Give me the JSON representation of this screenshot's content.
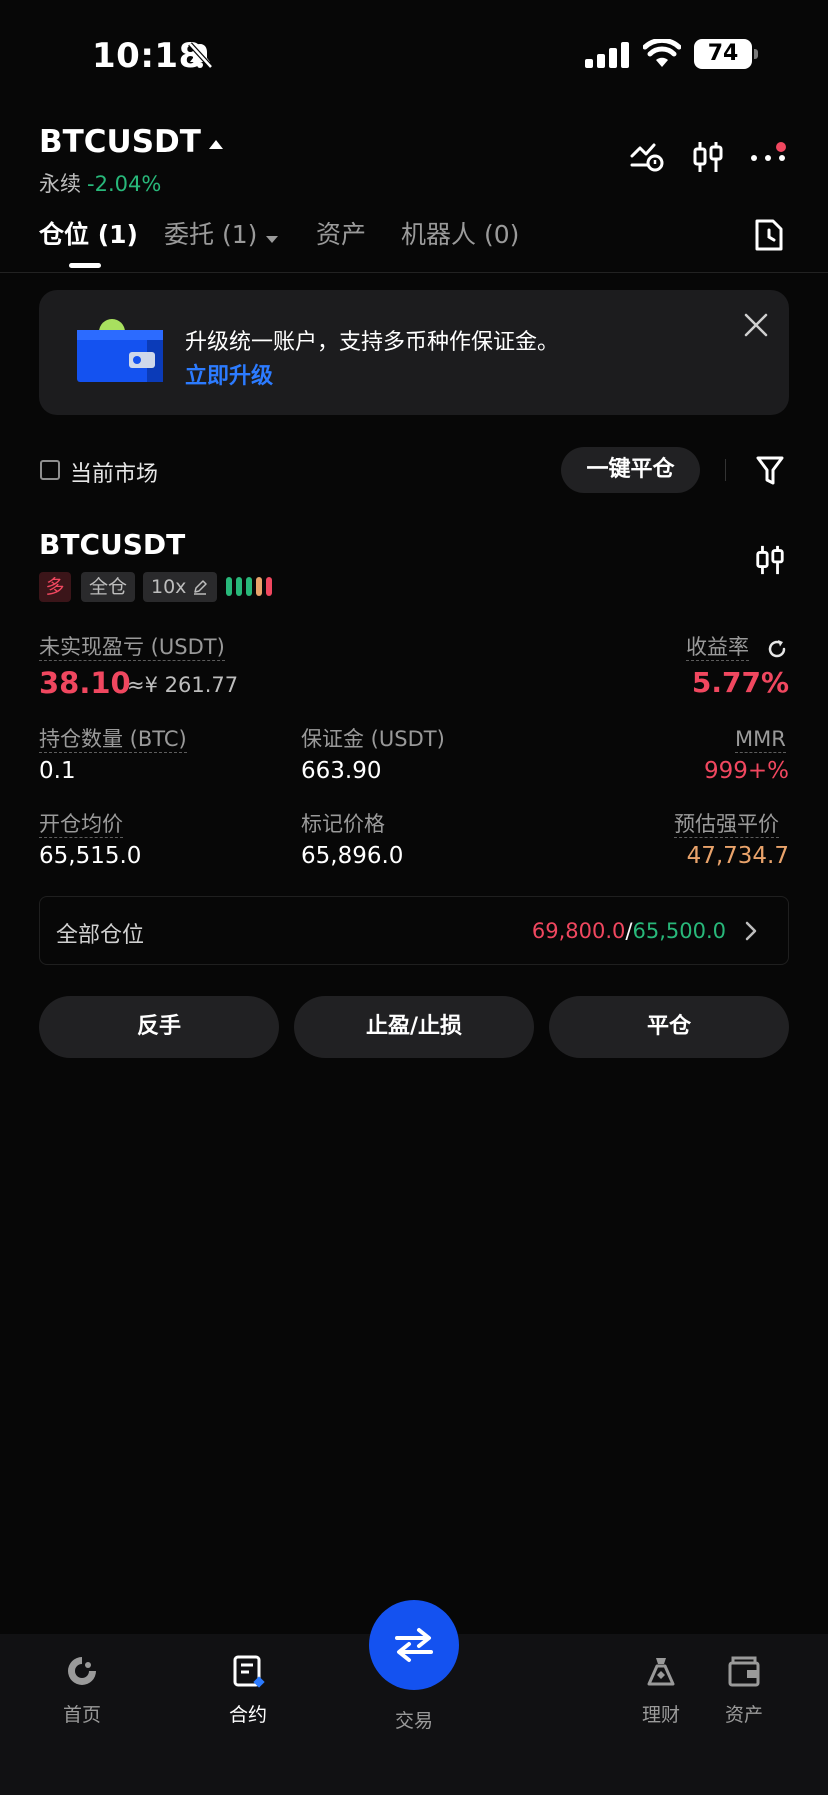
{
  "status_bar": {
    "time": "10:18",
    "battery": "74"
  },
  "header": {
    "pair": "BTCUSDT",
    "type": "永续",
    "change": "-2.04%"
  },
  "tabs": [
    {
      "label": "仓位 (1)"
    },
    {
      "label": "委托 (1)"
    },
    {
      "label": "资产"
    },
    {
      "label": "机器人 (0)"
    }
  ],
  "banner": {
    "title": "升级统一账户，支持多币种作保证金。",
    "link": "立即升级"
  },
  "filter": {
    "checkbox_label": "当前市场",
    "close_all": "一键平仓"
  },
  "position": {
    "symbol": "BTCUSDT",
    "tags": {
      "side": "多",
      "margin_mode": "全仓",
      "leverage": "10x"
    },
    "adl_colors": [
      "#28b87a",
      "#28b87a",
      "#28b87a",
      "#e9a36b",
      "#f0475f"
    ],
    "pnl": {
      "label": "未实现盈亏 (USDT)",
      "value": "38.10",
      "cny": "≈¥ 261.77"
    },
    "roe": {
      "label": "收益率",
      "value": "5.77%"
    },
    "size": {
      "label": "持仓数量 (BTC)",
      "value": "0.1"
    },
    "margin": {
      "label": "保证金 (USDT)",
      "value": "663.90"
    },
    "mmr": {
      "label": "MMR",
      "value": "999+%"
    },
    "entry": {
      "label": "开仓均价",
      "value": "65,515.0"
    },
    "mark": {
      "label": "标记价格",
      "value": "65,896.0"
    },
    "liq": {
      "label": "预估强平价",
      "value": "47,734.7"
    },
    "tpsl": {
      "label": "全部仓位",
      "tp": "69,800.0",
      "sep": "/",
      "sl": "65,500.0"
    },
    "buttons": {
      "reverse": "反手",
      "tpsl": "止盈/止损",
      "close": "平仓"
    }
  },
  "bottom_nav": [
    {
      "label": "首页",
      "icon": "home-icon"
    },
    {
      "label": "合约",
      "icon": "futures-icon"
    },
    {
      "label": "交易",
      "icon": "swap-icon"
    },
    {
      "label": "理财",
      "icon": "earn-icon"
    },
    {
      "label": "资产",
      "icon": "wallet-icon"
    }
  ],
  "colors": {
    "background": "#070707",
    "red": "#f0475f",
    "green": "#28b87a",
    "orange": "#e9a36b",
    "accent_blue": "#1452f0",
    "link_blue": "#2c7bff"
  }
}
